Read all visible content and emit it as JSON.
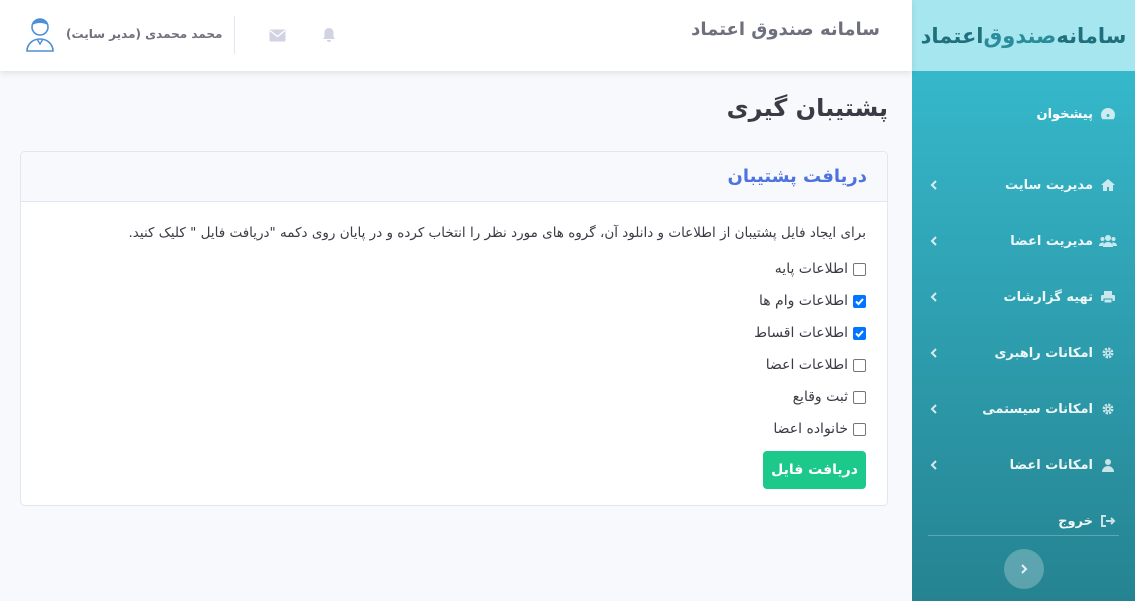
{
  "brand": {
    "part1": "سامانه",
    "part2": "صندوق",
    "part3": "اعتماد"
  },
  "topbar": {
    "site_title": "سامانه صندوق اعتماد",
    "user_name": "محمد محمدی (مدیر سایت)"
  },
  "sidebar": {
    "items": [
      {
        "label": "پیشخوان",
        "icon": "dashboard-icon",
        "has_children": false
      },
      {
        "label": "مدیریت سایت",
        "icon": "home-icon",
        "has_children": true
      },
      {
        "label": "مدیریت اعضا",
        "icon": "users-icon",
        "has_children": true
      },
      {
        "label": "تهیه گزارشات",
        "icon": "print-icon",
        "has_children": true
      },
      {
        "label": "امکانات راهبری",
        "icon": "gear-icon",
        "has_children": true
      },
      {
        "label": "امکانات سیستمی",
        "icon": "gear-icon",
        "has_children": true
      },
      {
        "label": "امکانات اعضا",
        "icon": "user-icon",
        "has_children": true
      },
      {
        "label": "خروج",
        "icon": "sign-out-icon",
        "has_children": false
      }
    ]
  },
  "main": {
    "page_title": "پشتیبان گیری",
    "card_title": "دریافت پشتیبان",
    "instructions": "برای ایجاد فایل پشتیبان از اطلاعات و دانلود آن، گروه های مورد نظر را انتخاب کرده و در پایان روی دکمه \"دریافت فایل \" کلیک کنید.",
    "options": [
      {
        "label": "اطلاعات پایه",
        "checked": false
      },
      {
        "label": "اطلاعات وام ها",
        "checked": true
      },
      {
        "label": "اطلاعات اقساط",
        "checked": true
      },
      {
        "label": "اطلاعات اعضا",
        "checked": false
      },
      {
        "label": "ثبت وقایع",
        "checked": false
      },
      {
        "label": "خانواده اعضا",
        "checked": false
      }
    ],
    "download_button": "دریافت فایل"
  },
  "colors": {
    "sidebar_top": "#36b9cc",
    "sidebar_bottom": "#258391",
    "brand_bg": "#a6e6ef",
    "card_title": "#4e73df",
    "button": "#1cc88a",
    "checkbox_checked": "#0075ff"
  }
}
